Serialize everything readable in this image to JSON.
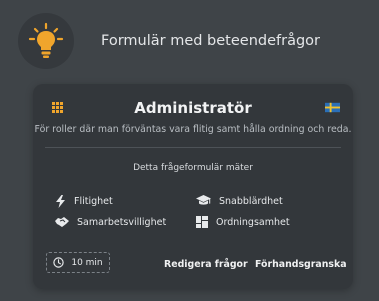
{
  "header": {
    "title": "Formulär med beteendefrågor",
    "logo_icon": "lightbulb-icon",
    "logo_color": "#f0a52c"
  },
  "card": {
    "title": "Administratör",
    "subtitle": "För roller där man förväntas vara flitig samt hålla ordning och reda.",
    "language_flag": "swedish-flag-icon",
    "measures_heading": "Detta frågeformulär mäter",
    "traits": [
      {
        "label": "Flitighet",
        "icon": "lightning-icon"
      },
      {
        "label": "Snabblärdhet",
        "icon": "graduation-cap-icon"
      },
      {
        "label": "Samarbetsvillighet",
        "icon": "handshake-icon"
      },
      {
        "label": "Ordningsamhet",
        "icon": "dashboard-icon"
      }
    ],
    "duration": "10 min",
    "edit_label": "Redigera frågor",
    "preview_label": "Förhandsgranska",
    "accent_color": "#f0a52c"
  }
}
